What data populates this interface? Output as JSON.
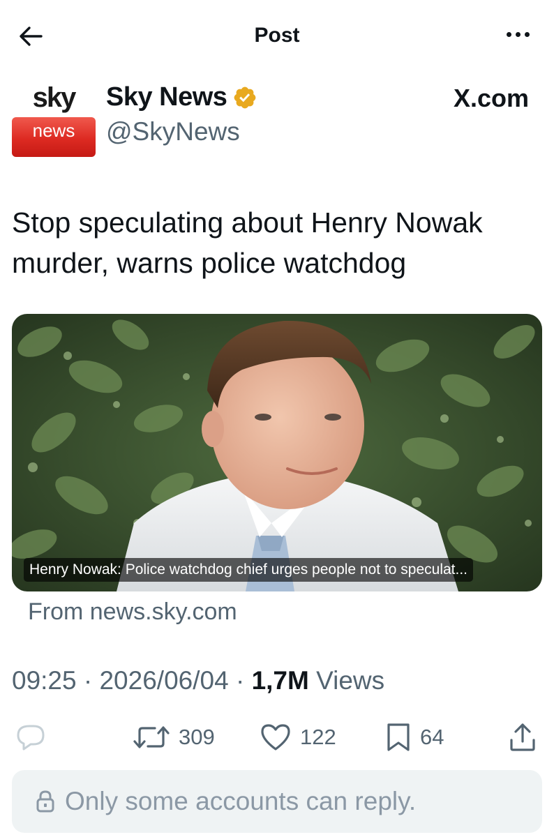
{
  "header": {
    "title": "Post",
    "back_icon": "arrow-left-icon",
    "more_icon": "more-horizontal-icon"
  },
  "author": {
    "logo_top": "sky",
    "logo_bottom": "news",
    "display_name": "Sky News",
    "verified_badge": "verified-gold-badge-icon",
    "handle": "@SkyNews",
    "badge_color": "#e8a91f"
  },
  "source_watermark": "X.com",
  "post": {
    "text": "Stop speculating about Henry Nowak murder, warns police watchdog"
  },
  "link_card": {
    "image_icon": "article-photo",
    "caption": "Henry Nowak: Police watchdog chief urges people not to speculat...",
    "source": "From news.sky.com"
  },
  "meta": {
    "time": "09:25",
    "date": "2026/06/04",
    "separator": "·",
    "views_count": "1,7M",
    "views_label": "Views"
  },
  "actions": {
    "reply_icon": "reply-icon",
    "repost_icon": "repost-icon",
    "repost_count": "309",
    "like_icon": "heart-icon",
    "like_count": "122",
    "bookmark_icon": "bookmark-icon",
    "bookmark_count": "64",
    "share_icon": "share-icon"
  },
  "reply_restriction": {
    "icon": "lock-icon",
    "text": "Only some accounts can reply."
  },
  "colors": {
    "text_primary": "#0f1419",
    "text_secondary": "#536471",
    "sky_red": "#dd2a22",
    "reply_box_bg": "#eff3f4"
  }
}
